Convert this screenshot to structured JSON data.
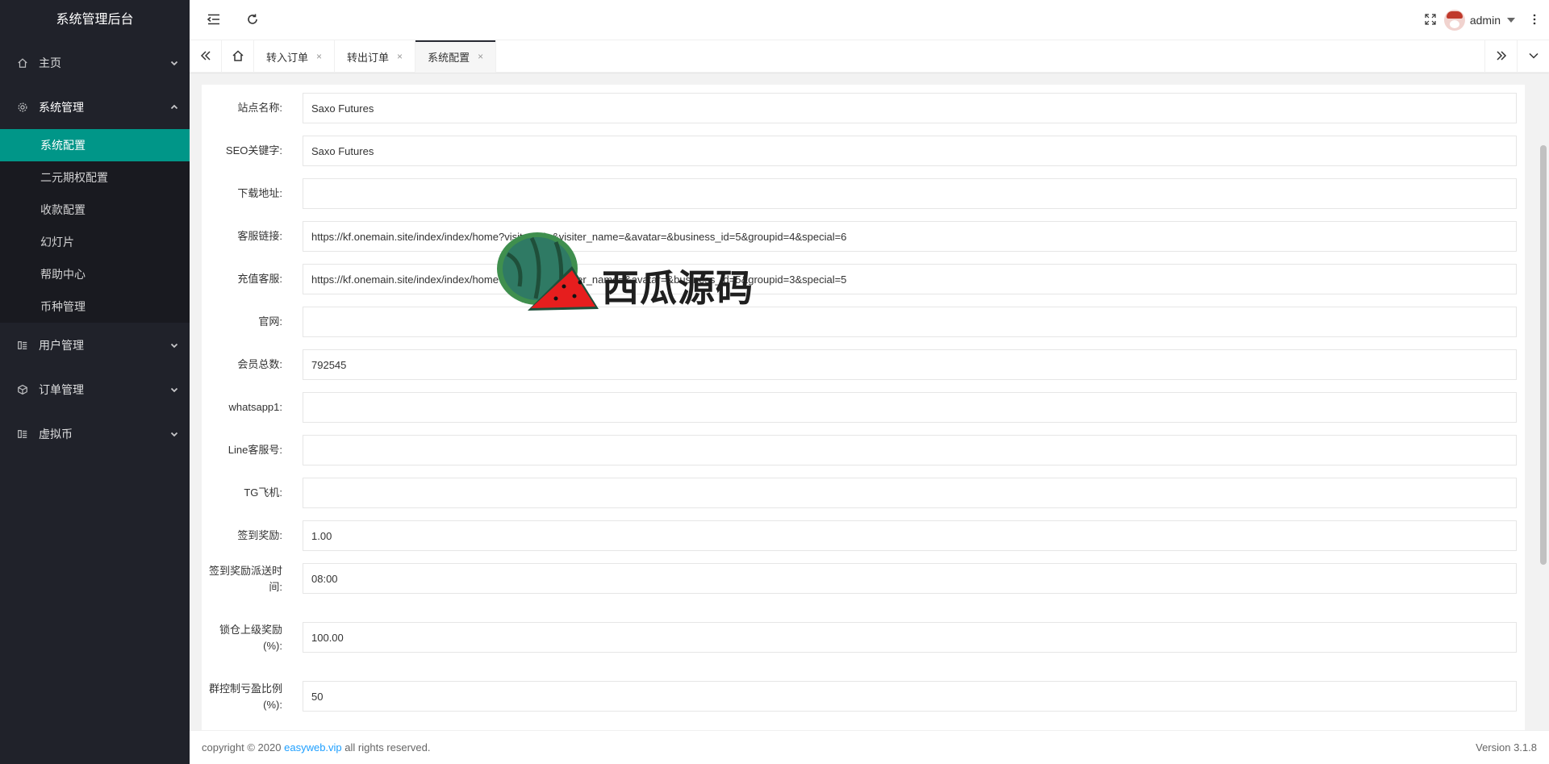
{
  "app": {
    "title": "系统管理后台"
  },
  "sidebar": {
    "items": [
      {
        "label": "主页"
      },
      {
        "label": "系统管理",
        "subitems": [
          "系统配置",
          "二元期权配置",
          "收款配置",
          "幻灯片",
          "帮助中心",
          "币种管理"
        ]
      },
      {
        "label": "用户管理"
      },
      {
        "label": "订单管理"
      },
      {
        "label": "虚拟币"
      }
    ]
  },
  "header": {
    "user": "admin"
  },
  "tabs": [
    {
      "label": "转入订单",
      "close": "×"
    },
    {
      "label": "转出订单",
      "close": "×"
    },
    {
      "label": "系统配置",
      "close": "×"
    }
  ],
  "form": {
    "fields": [
      {
        "label": "站点名称:",
        "value": "Saxo Futures"
      },
      {
        "label": "SEO关键字:",
        "value": "Saxo Futures"
      },
      {
        "label": "下载地址:",
        "value": ""
      },
      {
        "label": "客服链接:",
        "value": "https://kf.onemain.site/index/index/home?visiter_id=&visiter_name=&avatar=&business_id=5&groupid=4&special=6"
      },
      {
        "label": "充值客服:",
        "value": "https://kf.onemain.site/index/index/home?visiter_id=&visiter_name=&avatar=&business_id=5&groupid=3&special=5"
      },
      {
        "label": "官网:",
        "value": ""
      },
      {
        "label": "会员总数:",
        "value": "792545"
      },
      {
        "label": "whatsapp1:",
        "value": ""
      },
      {
        "label": "Line客服号:",
        "value": ""
      },
      {
        "label": "TG飞机:",
        "value": ""
      },
      {
        "label": "签到奖励:",
        "value": "1.00"
      },
      {
        "label": "签到奖励派送时间:",
        "value": "08:00"
      },
      {
        "label": "锁仓上级奖励(%):",
        "value": "100.00"
      },
      {
        "label": "群控制亏盈比例(%):",
        "value": "50"
      }
    ]
  },
  "footer": {
    "prefix": "copyright © 2020",
    "link": "easyweb.vip",
    "suffix": "all rights reserved.",
    "version": "Version 3.1.8"
  },
  "watermark": {
    "text": "西瓜源码"
  }
}
